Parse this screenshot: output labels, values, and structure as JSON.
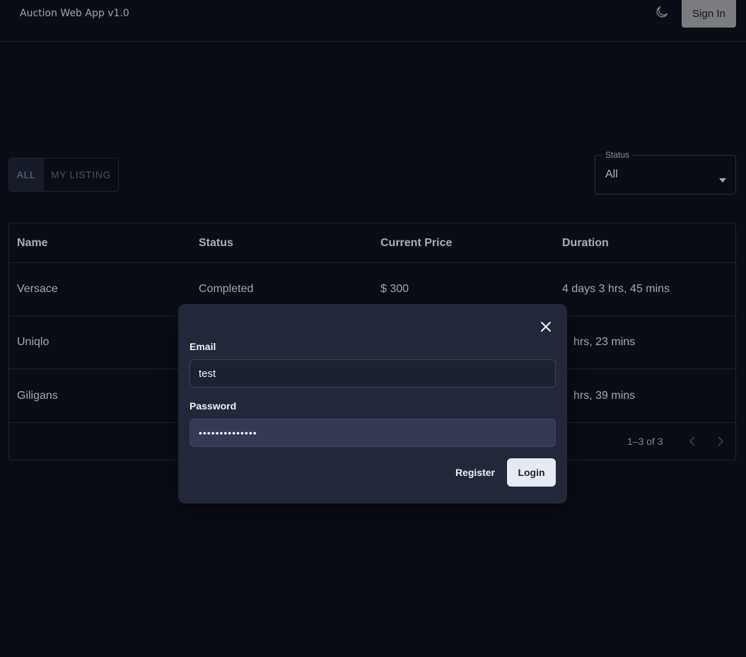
{
  "header": {
    "app_title": "Auction Web App v1.0",
    "theme_icon": "moon-icon",
    "signin_label": "Sign In"
  },
  "filters": {
    "tabs": [
      {
        "label": "ALL",
        "selected": true
      },
      {
        "label": "MY LISTING",
        "selected": false
      }
    ],
    "status": {
      "legend": "Status",
      "value": "All"
    }
  },
  "table": {
    "columns": [
      "Name",
      "Status",
      "Current Price",
      "Duration"
    ],
    "rows": [
      {
        "name": "Versace",
        "status": "Completed",
        "price": "$ 300",
        "duration": "4 days 3 hrs, 45 mins"
      },
      {
        "name": "Uniqlo",
        "status": "",
        "price": "",
        "duration": "hrs, 23 mins"
      },
      {
        "name": "Giligans",
        "status": "",
        "price": "",
        "duration": "hrs, 39 mins"
      }
    ],
    "pagination": {
      "text": "1–3 of 3"
    }
  },
  "login_modal": {
    "email_label": "Email",
    "email_value": "test",
    "password_label": "Password",
    "password_value": "••••••••••••••",
    "register_label": "Register",
    "login_label": "Login"
  },
  "colors": {
    "background": "#0b0d16",
    "modal": "#222839",
    "login_button": "#e7eaf1",
    "signin_button": "#7a7c80"
  }
}
